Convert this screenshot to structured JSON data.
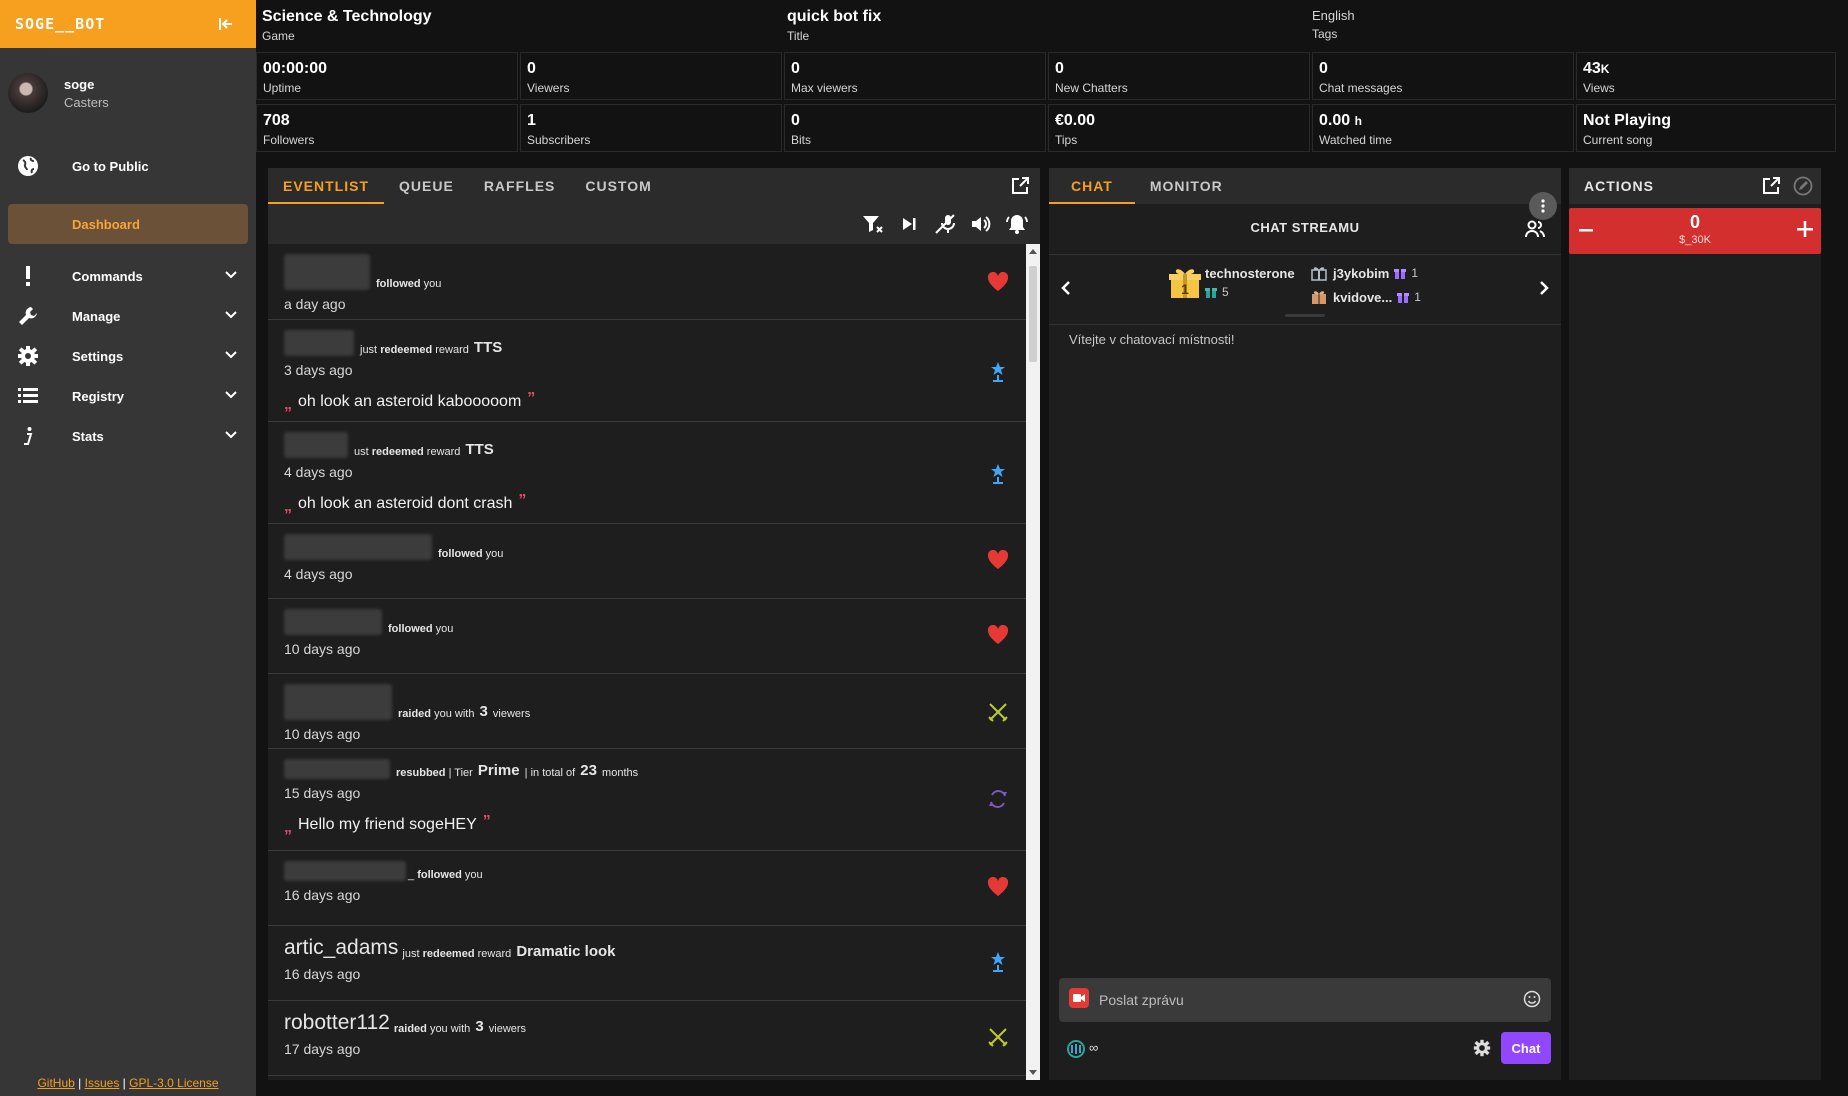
{
  "sidebar": {
    "brand": "SOGE__BOT",
    "user": {
      "name": "soge",
      "role": "Casters"
    },
    "public_label": "Go to Public",
    "dashboard_label": "Dashboard",
    "items": [
      {
        "label": "Commands",
        "icon": "exclamation-icon"
      },
      {
        "label": "Manage",
        "icon": "wrench-icon"
      },
      {
        "label": "Settings",
        "icon": "gear-icon"
      },
      {
        "label": "Registry",
        "icon": "list-icon"
      },
      {
        "label": "Stats",
        "icon": "info-icon"
      }
    ],
    "footer": {
      "github": "GitHub",
      "issues": "Issues",
      "license": "GPL-3.0 License",
      "sep": "|"
    }
  },
  "stats": {
    "game": {
      "value": "Science & Technology",
      "label": "Game"
    },
    "title": {
      "value": "quick bot fix",
      "label": "Title"
    },
    "tags": {
      "value": "English",
      "label": "Tags"
    },
    "uptime": {
      "value": "00:00:00",
      "label": "Uptime"
    },
    "viewers": {
      "value": "0",
      "label": "Viewers"
    },
    "max_viewers": {
      "value": "0",
      "label": "Max viewers"
    },
    "new_chatters": {
      "value": "0",
      "label": "New Chatters"
    },
    "chat_messages": {
      "value": "0",
      "label": "Chat messages"
    },
    "views": {
      "value": "43",
      "suffix": "K",
      "label": "Views"
    },
    "followers": {
      "value": "708",
      "label": "Followers"
    },
    "subscribers": {
      "value": "1",
      "label": "Subscribers"
    },
    "bits": {
      "value": "0",
      "label": "Bits"
    },
    "tips": {
      "value": "€0.00",
      "label": "Tips"
    },
    "watched": {
      "value": "0.00",
      "suffix": "h",
      "label": "Watched time"
    },
    "song": {
      "value": "Not Playing",
      "label": "Current song"
    }
  },
  "eventlist": {
    "tabs": [
      "EVENTLIST",
      "QUEUE",
      "RAFFLES",
      "CUSTOM"
    ],
    "events": [
      {
        "type": "follow",
        "parts": [
          "followed",
          "you"
        ],
        "time": "a day ago"
      },
      {
        "type": "reward",
        "parts": [
          "just",
          "redeemed",
          "reward",
          "TTS"
        ],
        "time": "3 days ago",
        "message": "oh look an asteroid kabooooom"
      },
      {
        "type": "reward",
        "parts": [
          "ust",
          "redeemed",
          "reward",
          "TTS"
        ],
        "time": "4 days ago",
        "message": "oh look an asteroid dont crash"
      },
      {
        "type": "follow",
        "parts": [
          "followed",
          "you"
        ],
        "time": "4 days ago"
      },
      {
        "type": "follow",
        "parts": [
          "followed",
          "you"
        ],
        "time": "10 days ago"
      },
      {
        "type": "raid",
        "parts": [
          "raided",
          "you with",
          "3",
          "viewers"
        ],
        "time": "10 days ago"
      },
      {
        "type": "resub",
        "parts": [
          "resubbed",
          "| Tier",
          "Prime",
          "| in total of",
          "23",
          "months"
        ],
        "time": "15 days ago",
        "message": "Hello my friend sogeHEY"
      },
      {
        "type": "follow",
        "parts": [
          "_",
          "followed",
          "you"
        ],
        "time": "16 days ago"
      },
      {
        "type": "reward",
        "username": "artic_adams",
        "parts": [
          "just",
          "redeemed",
          "reward",
          "Dramatic look"
        ],
        "time": "16 days ago"
      },
      {
        "type": "raid",
        "username": "robotter112",
        "parts": [
          "raided",
          "you with",
          "3",
          "viewers"
        ],
        "time": "17 days ago"
      }
    ],
    "quote_open": "„",
    "quote_close": "”"
  },
  "chat": {
    "tabs": [
      "CHAT",
      "MONITOR"
    ],
    "title": "CHAT STREAMU",
    "gifters": {
      "top": {
        "name": "technosterone",
        "count": "5",
        "rank": "1"
      },
      "others": [
        {
          "name": "j3ykobim",
          "count": "1"
        },
        {
          "name": "kvidove...",
          "count": "1"
        }
      ]
    },
    "welcome": "Vítejte v chatovací místnosti!",
    "input_placeholder": "Poslat zprávu",
    "infinity": "∞",
    "send_label": "Chat"
  },
  "actions": {
    "title": "ACTIONS",
    "counter": {
      "value": "0",
      "label": "$_30K"
    }
  },
  "colors": {
    "accent": "#f79f1f",
    "danger": "#d32f2f",
    "twitch": "#9146ff",
    "heart": "#e53935",
    "reward": "#42a5f5",
    "raid": "#c0ca33",
    "resub": "#7e57c2"
  }
}
